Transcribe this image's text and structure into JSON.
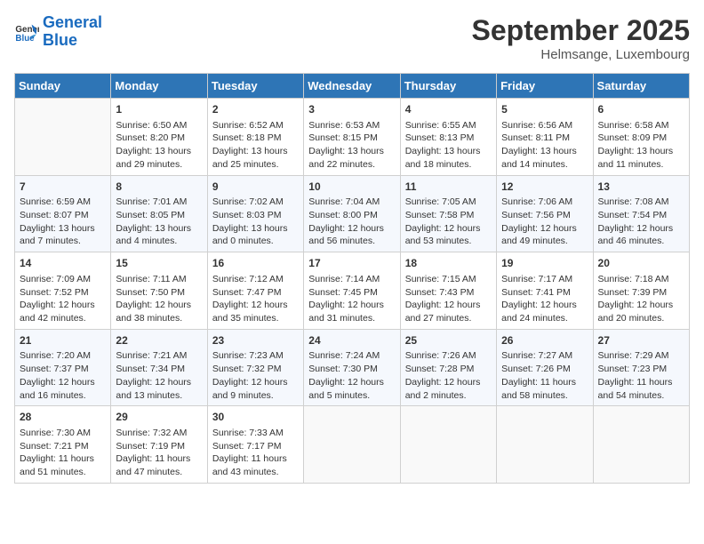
{
  "logo": {
    "text_general": "General",
    "text_blue": "Blue"
  },
  "header": {
    "month": "September 2025",
    "location": "Helmsange, Luxembourg"
  },
  "weekdays": [
    "Sunday",
    "Monday",
    "Tuesday",
    "Wednesday",
    "Thursday",
    "Friday",
    "Saturday"
  ],
  "weeks": [
    [
      {
        "day": "",
        "info": ""
      },
      {
        "day": "1",
        "info": "Sunrise: 6:50 AM\nSunset: 8:20 PM\nDaylight: 13 hours\nand 29 minutes."
      },
      {
        "day": "2",
        "info": "Sunrise: 6:52 AM\nSunset: 8:18 PM\nDaylight: 13 hours\nand 25 minutes."
      },
      {
        "day": "3",
        "info": "Sunrise: 6:53 AM\nSunset: 8:15 PM\nDaylight: 13 hours\nand 22 minutes."
      },
      {
        "day": "4",
        "info": "Sunrise: 6:55 AM\nSunset: 8:13 PM\nDaylight: 13 hours\nand 18 minutes."
      },
      {
        "day": "5",
        "info": "Sunrise: 6:56 AM\nSunset: 8:11 PM\nDaylight: 13 hours\nand 14 minutes."
      },
      {
        "day": "6",
        "info": "Sunrise: 6:58 AM\nSunset: 8:09 PM\nDaylight: 13 hours\nand 11 minutes."
      }
    ],
    [
      {
        "day": "7",
        "info": "Sunrise: 6:59 AM\nSunset: 8:07 PM\nDaylight: 13 hours\nand 7 minutes."
      },
      {
        "day": "8",
        "info": "Sunrise: 7:01 AM\nSunset: 8:05 PM\nDaylight: 13 hours\nand 4 minutes."
      },
      {
        "day": "9",
        "info": "Sunrise: 7:02 AM\nSunset: 8:03 PM\nDaylight: 13 hours\nand 0 minutes."
      },
      {
        "day": "10",
        "info": "Sunrise: 7:04 AM\nSunset: 8:00 PM\nDaylight: 12 hours\nand 56 minutes."
      },
      {
        "day": "11",
        "info": "Sunrise: 7:05 AM\nSunset: 7:58 PM\nDaylight: 12 hours\nand 53 minutes."
      },
      {
        "day": "12",
        "info": "Sunrise: 7:06 AM\nSunset: 7:56 PM\nDaylight: 12 hours\nand 49 minutes."
      },
      {
        "day": "13",
        "info": "Sunrise: 7:08 AM\nSunset: 7:54 PM\nDaylight: 12 hours\nand 46 minutes."
      }
    ],
    [
      {
        "day": "14",
        "info": "Sunrise: 7:09 AM\nSunset: 7:52 PM\nDaylight: 12 hours\nand 42 minutes."
      },
      {
        "day": "15",
        "info": "Sunrise: 7:11 AM\nSunset: 7:50 PM\nDaylight: 12 hours\nand 38 minutes."
      },
      {
        "day": "16",
        "info": "Sunrise: 7:12 AM\nSunset: 7:47 PM\nDaylight: 12 hours\nand 35 minutes."
      },
      {
        "day": "17",
        "info": "Sunrise: 7:14 AM\nSunset: 7:45 PM\nDaylight: 12 hours\nand 31 minutes."
      },
      {
        "day": "18",
        "info": "Sunrise: 7:15 AM\nSunset: 7:43 PM\nDaylight: 12 hours\nand 27 minutes."
      },
      {
        "day": "19",
        "info": "Sunrise: 7:17 AM\nSunset: 7:41 PM\nDaylight: 12 hours\nand 24 minutes."
      },
      {
        "day": "20",
        "info": "Sunrise: 7:18 AM\nSunset: 7:39 PM\nDaylight: 12 hours\nand 20 minutes."
      }
    ],
    [
      {
        "day": "21",
        "info": "Sunrise: 7:20 AM\nSunset: 7:37 PM\nDaylight: 12 hours\nand 16 minutes."
      },
      {
        "day": "22",
        "info": "Sunrise: 7:21 AM\nSunset: 7:34 PM\nDaylight: 12 hours\nand 13 minutes."
      },
      {
        "day": "23",
        "info": "Sunrise: 7:23 AM\nSunset: 7:32 PM\nDaylight: 12 hours\nand 9 minutes."
      },
      {
        "day": "24",
        "info": "Sunrise: 7:24 AM\nSunset: 7:30 PM\nDaylight: 12 hours\nand 5 minutes."
      },
      {
        "day": "25",
        "info": "Sunrise: 7:26 AM\nSunset: 7:28 PM\nDaylight: 12 hours\nand 2 minutes."
      },
      {
        "day": "26",
        "info": "Sunrise: 7:27 AM\nSunset: 7:26 PM\nDaylight: 11 hours\nand 58 minutes."
      },
      {
        "day": "27",
        "info": "Sunrise: 7:29 AM\nSunset: 7:23 PM\nDaylight: 11 hours\nand 54 minutes."
      }
    ],
    [
      {
        "day": "28",
        "info": "Sunrise: 7:30 AM\nSunset: 7:21 PM\nDaylight: 11 hours\nand 51 minutes."
      },
      {
        "day": "29",
        "info": "Sunrise: 7:32 AM\nSunset: 7:19 PM\nDaylight: 11 hours\nand 47 minutes."
      },
      {
        "day": "30",
        "info": "Sunrise: 7:33 AM\nSunset: 7:17 PM\nDaylight: 11 hours\nand 43 minutes."
      },
      {
        "day": "",
        "info": ""
      },
      {
        "day": "",
        "info": ""
      },
      {
        "day": "",
        "info": ""
      },
      {
        "day": "",
        "info": ""
      }
    ]
  ]
}
